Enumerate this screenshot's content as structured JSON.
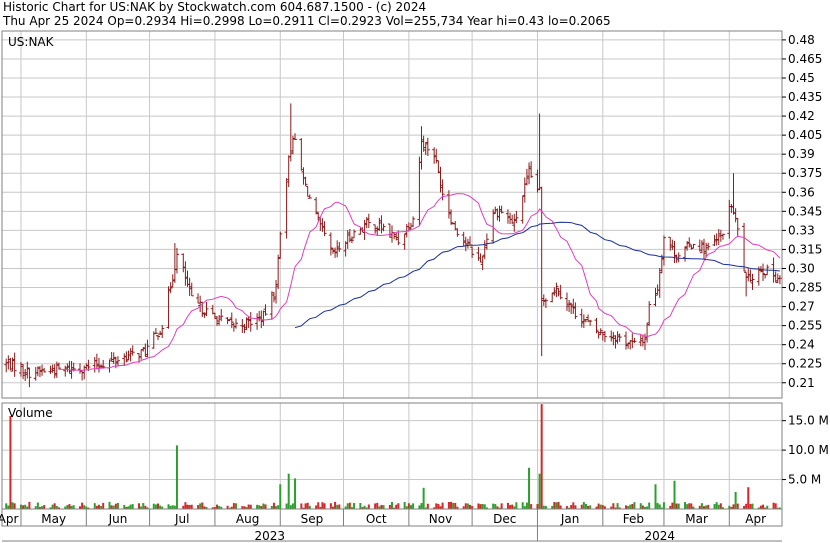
{
  "header": {
    "title_line": "Historic Chart for US:NAK by Stockwatch.com 604.687.1500 - (c) 2024",
    "stats_line": "Thu Apr 25 2024   Op=0.2934   Hi=0.2998   Lo=0.2911   Cl=0.2923   Vol=255,734   Year hi=0.43   lo=0.2065"
  },
  "colors": {
    "price_bar": "#8b1a1a",
    "ma_short": "#e040c0",
    "ma_long": "#1a2f9a",
    "vol_up": "#2ca02c",
    "vol_down": "#d62728",
    "grid": "#c8c8c8",
    "frame": "#808080"
  },
  "chart_data": [
    {
      "type": "bar",
      "subtype": "ohlc",
      "panel": "price",
      "symbol_label": "US:NAK",
      "y_ticks": [
        "0.21",
        "0.225",
        "0.24",
        "0.255",
        "0.27",
        "0.285",
        "0.30",
        "0.315",
        "0.33",
        "0.345",
        "0.36",
        "0.375",
        "0.39",
        "0.405",
        "0.42",
        "0.435",
        "0.45",
        "0.465",
        "0.48"
      ],
      "ylim": [
        0.198,
        0.487
      ],
      "x_ticks": [
        "Apr",
        "May",
        "Jun",
        "Jul",
        "Aug",
        "Sep",
        "Oct",
        "Nov",
        "Dec",
        "Jan",
        "Feb",
        "Mar",
        "Apr"
      ],
      "year_labels": [
        "2023",
        "2024"
      ],
      "grid": true,
      "close_anchors": [
        {
          "date": "2023-04-25",
          "close": 0.225
        },
        {
          "date": "2023-05-05",
          "close": 0.218
        },
        {
          "date": "2023-05-15",
          "close": 0.22
        },
        {
          "date": "2023-06-01",
          "close": 0.222
        },
        {
          "date": "2023-06-15",
          "close": 0.228
        },
        {
          "date": "2023-06-29",
          "close": 0.235
        },
        {
          "date": "2023-07-07",
          "close": 0.255
        },
        {
          "date": "2023-07-14",
          "close": 0.31
        },
        {
          "date": "2023-07-17",
          "close": 0.298
        },
        {
          "date": "2023-07-21",
          "close": 0.275
        },
        {
          "date": "2023-07-31",
          "close": 0.262
        },
        {
          "date": "2023-08-10",
          "close": 0.255
        },
        {
          "date": "2023-08-18",
          "close": 0.258
        },
        {
          "date": "2023-08-24",
          "close": 0.262
        },
        {
          "date": "2023-08-30",
          "close": 0.285
        },
        {
          "date": "2023-09-01",
          "close": 0.33
        },
        {
          "date": "2023-09-05",
          "close": 0.385
        },
        {
          "date": "2023-09-07",
          "close": 0.405
        },
        {
          "date": "2023-09-12",
          "close": 0.37
        },
        {
          "date": "2023-09-18",
          "close": 0.34
        },
        {
          "date": "2023-09-26",
          "close": 0.31
        },
        {
          "date": "2023-10-04",
          "close": 0.325
        },
        {
          "date": "2023-10-12",
          "close": 0.335
        },
        {
          "date": "2023-10-20",
          "close": 0.332
        },
        {
          "date": "2023-10-27",
          "close": 0.322
        },
        {
          "date": "2023-11-03",
          "close": 0.34
        },
        {
          "date": "2023-11-07",
          "close": 0.4
        },
        {
          "date": "2023-11-13",
          "close": 0.39
        },
        {
          "date": "2023-11-17",
          "close": 0.36
        },
        {
          "date": "2023-11-22",
          "close": 0.335
        },
        {
          "date": "2023-11-28",
          "close": 0.32
        },
        {
          "date": "2023-12-05",
          "close": 0.305
        },
        {
          "date": "2023-12-11",
          "close": 0.345
        },
        {
          "date": "2023-12-15",
          "close": 0.345
        },
        {
          "date": "2023-12-21",
          "close": 0.335
        },
        {
          "date": "2023-12-28",
          "close": 0.375
        },
        {
          "date": "2024-01-02",
          "close": 0.36
        },
        {
          "date": "2024-01-03",
          "close": 0.275
        },
        {
          "date": "2024-01-10",
          "close": 0.285
        },
        {
          "date": "2024-01-19",
          "close": 0.265
        },
        {
          "date": "2024-01-30",
          "close": 0.25
        },
        {
          "date": "2024-02-09",
          "close": 0.245
        },
        {
          "date": "2024-02-16",
          "close": 0.24
        },
        {
          "date": "2024-02-21",
          "close": 0.245
        },
        {
          "date": "2024-02-23",
          "close": 0.27
        },
        {
          "date": "2024-02-27",
          "close": 0.285
        },
        {
          "date": "2024-03-01",
          "close": 0.325
        },
        {
          "date": "2024-03-07",
          "close": 0.31
        },
        {
          "date": "2024-03-15",
          "close": 0.32
        },
        {
          "date": "2024-03-22",
          "close": 0.315
        },
        {
          "date": "2024-03-28",
          "close": 0.325
        },
        {
          "date": "2024-04-02",
          "close": 0.35
        },
        {
          "date": "2024-04-05",
          "close": 0.33
        },
        {
          "date": "2024-04-09",
          "close": 0.29
        },
        {
          "date": "2024-04-16",
          "close": 0.3
        },
        {
          "date": "2024-04-25",
          "close": 0.2923
        }
      ],
      "series": [
        {
          "style": "ohlc-bars"
        },
        {
          "style": "moving-average",
          "window_days": 20
        },
        {
          "style": "moving-average",
          "window_days": 100
        }
      ]
    },
    {
      "type": "bar",
      "panel": "volume",
      "panel_title": "Volume",
      "y_ticks": [
        "5.0 M",
        "10.0 M",
        "15.0 M"
      ],
      "ylim": [
        0,
        18000000
      ],
      "spikes": [
        {
          "date": "2023-04-26",
          "volume": 15800000,
          "direction": "down"
        },
        {
          "date": "2023-07-14",
          "volume": 10800000,
          "direction": "up"
        },
        {
          "date": "2023-09-01",
          "volume": 4200000,
          "direction": "up"
        },
        {
          "date": "2023-09-05",
          "volume": 6000000,
          "direction": "up"
        },
        {
          "date": "2023-09-08",
          "volume": 5200000,
          "direction": "up"
        },
        {
          "date": "2023-11-08",
          "volume": 3600000,
          "direction": "up"
        },
        {
          "date": "2023-12-28",
          "volume": 7000000,
          "direction": "up"
        },
        {
          "date": "2024-01-02",
          "volume": 6000000,
          "direction": "up"
        },
        {
          "date": "2024-01-03",
          "volume": 17800000,
          "direction": "down"
        },
        {
          "date": "2024-02-26",
          "volume": 4200000,
          "direction": "up"
        },
        {
          "date": "2024-03-06",
          "volume": 4800000,
          "direction": "up"
        },
        {
          "date": "2024-04-04",
          "volume": 2900000,
          "direction": "up"
        },
        {
          "date": "2024-04-10",
          "volume": 3700000,
          "direction": "down"
        }
      ],
      "base_volume": 900000,
      "latest_volume": 255734
    }
  ]
}
